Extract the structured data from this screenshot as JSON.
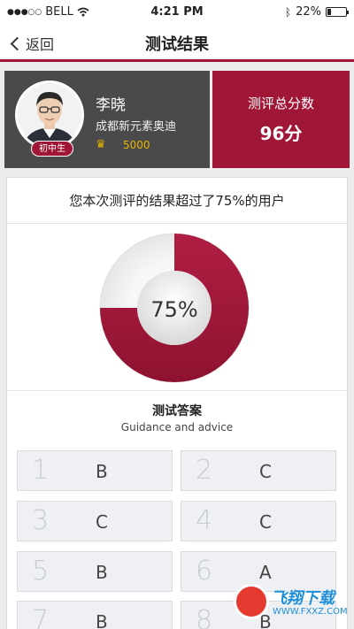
{
  "status_bar": {
    "carrier": "BELL",
    "time": "4:21 PM",
    "battery": "22%",
    "battery_level": 0.22
  },
  "nav": {
    "back_label": "返回",
    "title": "测试结果"
  },
  "profile": {
    "name": "李晓",
    "school": "成都新元素奥迪",
    "grade": "初中生",
    "points": "5000"
  },
  "score": {
    "label": "测评总分数",
    "value": "96分"
  },
  "result": {
    "summary": "您本次测评的结果超过了75%的用户",
    "percent_label": "75%",
    "percent": 75
  },
  "guidance": {
    "title": "测试答案",
    "subtitle": "Guidance and advice"
  },
  "answers": [
    {
      "num": "1",
      "letter": "B"
    },
    {
      "num": "2",
      "letter": "C"
    },
    {
      "num": "3",
      "letter": "C"
    },
    {
      "num": "4",
      "letter": "C"
    },
    {
      "num": "5",
      "letter": "B"
    },
    {
      "num": "6",
      "letter": "A"
    },
    {
      "num": "7",
      "letter": "B"
    },
    {
      "num": "8",
      "letter": "B"
    }
  ],
  "watermark": {
    "brand": "飞翔下载",
    "url": "WWW.FXXZ.COM"
  },
  "colors": {
    "accent": "#a01636",
    "profile_bg": "#4a4a4a",
    "gold": "#e6b400"
  }
}
